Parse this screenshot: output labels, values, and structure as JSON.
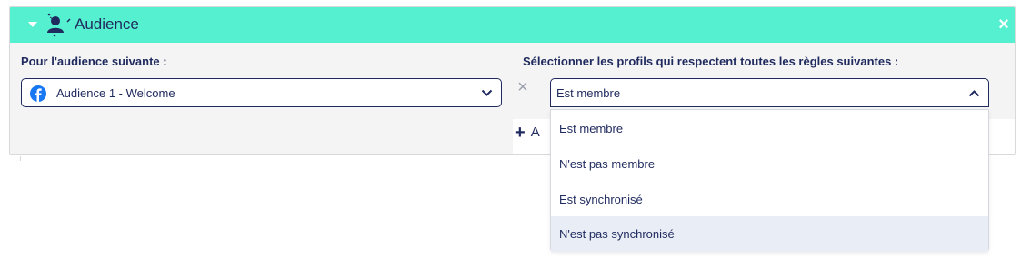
{
  "header": {
    "title": "Audience",
    "close_label": "×"
  },
  "left": {
    "label": "Pour l'audience suivante :",
    "select_value": "Audience 1 - Welcome",
    "select_icon": "facebook-icon"
  },
  "right": {
    "label": "Sélectionner les profils qui respectent toutes les règles suivantes :",
    "rule_value": "Est membre",
    "remove_label": "×",
    "add_label": "A"
  },
  "dropdown": {
    "options": [
      "Est membre",
      "N'est pas membre",
      "Est synchronisé",
      "N'est pas synchronisé"
    ],
    "highlighted_index": 3
  },
  "colors": {
    "header_bg": "#55f0cf",
    "text": "#1f2a5e",
    "facebook": "#1877f2",
    "highlight": "#e9eef6"
  }
}
